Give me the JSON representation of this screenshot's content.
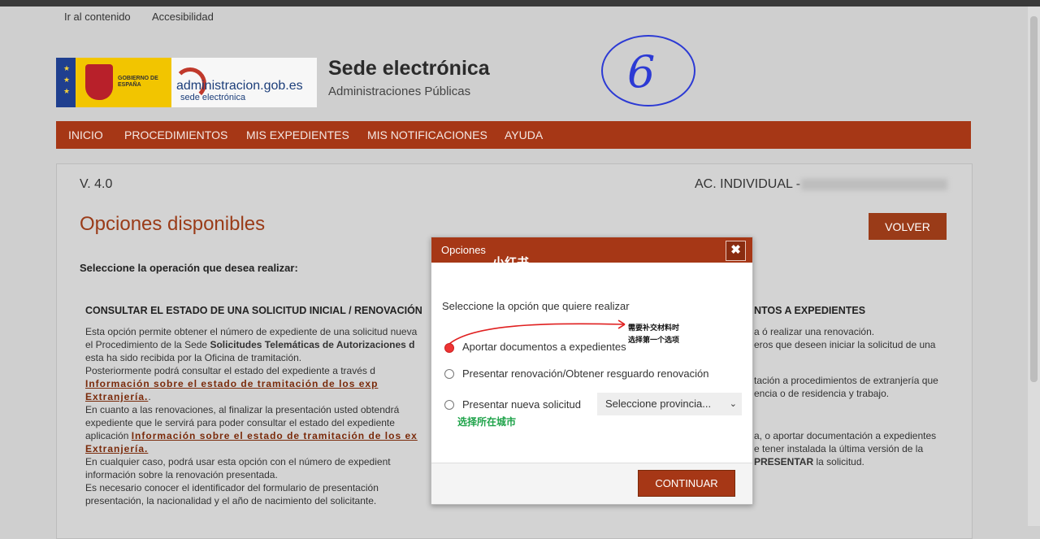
{
  "skip_links": [
    "Ir al contenido",
    "Accesibilidad"
  ],
  "logos": {
    "gobierno": "GOBIERNO DE ESPAÑA",
    "admin_main": "administracion.gob.es",
    "admin_sub": "sede electrónica"
  },
  "site": {
    "title": "Sede electrónica",
    "subtitle": "Administraciones Públicas"
  },
  "annotation_number": "6",
  "nav": [
    "INICIO",
    "PROCEDIMIENTOS",
    "MIS EXPEDIENTES",
    "MIS NOTIFICACIONES",
    "AYUDA"
  ],
  "main": {
    "version": "V. 4.0",
    "account": "AC. INDIVIDUAL -",
    "title": "Opciones disponibles",
    "back_button": "VOLVER",
    "instruction": "Seleccione la operación que desea realizar:",
    "left": {
      "heading": "CONSULTAR EL ESTADO DE UNA SOLICITUD INICIAL / RENOVACIÓN",
      "p1_a": "Esta opción permite obtener el número de expediente de una solicitud nueva",
      "p1_b": "el Procedimiento de la Sede",
      "p1_bold": "Solicitudes Telemáticas de Autorizaciones d",
      "p1_c": "esta ha sido recibida por la Oficina de tramitación.",
      "p2": "Posteriormente podrá consultar el estado del expediente a través d",
      "link1": "Información sobre el estado de tramitación de los exp",
      "link1_end": "Extranjería.",
      "p3_a": "En cuanto a las renovaciones, al finalizar la presentación usted obtendrá",
      "p3_b": "expediente que le servirá para poder consultar el estado del expediente",
      "p3_c": "aplicación",
      "link2": "Información sobre el estado de tramitación de los ex",
      "link2_end": "Extranjería.",
      "p4_a": "En cualquier caso, podrá usar esta opción con el número de expedient",
      "p4_b": "información sobre la renovación presentada.",
      "p5_a": "Es necesario conocer el identificador del formulario de presentación",
      "p5_b": "presentación, la nacionalidad y el año de nacimiento del solicitante."
    },
    "right": {
      "heading": "NTOS A EXPEDIENTES",
      "r1": "a ó realizar una renovación.",
      "r2": "eros que deseen iniciar la solicitud de una",
      "r3": "tación a procedimientos de extranjería que",
      "r4": "encia o de residencia y trabajo.",
      "r5": "a, o aportar documentación a expedientes",
      "r6": "e tener instalada la última versión de la",
      "r7_bold": "PRESENTAR",
      "r7_rest": "la solicitud."
    }
  },
  "modal": {
    "title": "Opciones",
    "close": "✖",
    "watermark": "小红书",
    "question": "Seleccione la opción que quiere realizar",
    "options": [
      {
        "label": "Aportar documentos a expedientes",
        "selected": true
      },
      {
        "label": "Presentar renovación/Obtener resguardo renovación",
        "selected": false
      },
      {
        "label": "Presentar nueva solicitud",
        "selected": false
      }
    ],
    "province_select": "Seleccione provincia...",
    "annotation_top_1": "需要补交材料时",
    "annotation_top_2": "选择第一个选项",
    "annotation_city": "选择所在城市",
    "continue_button": "CONTINUAR"
  },
  "colors": {
    "brand": "#a63716",
    "title": "#9a3b18",
    "annotation_blue": "#2c3ad4",
    "annotation_green": "#1fa34a",
    "annotation_red": "#e02020"
  }
}
